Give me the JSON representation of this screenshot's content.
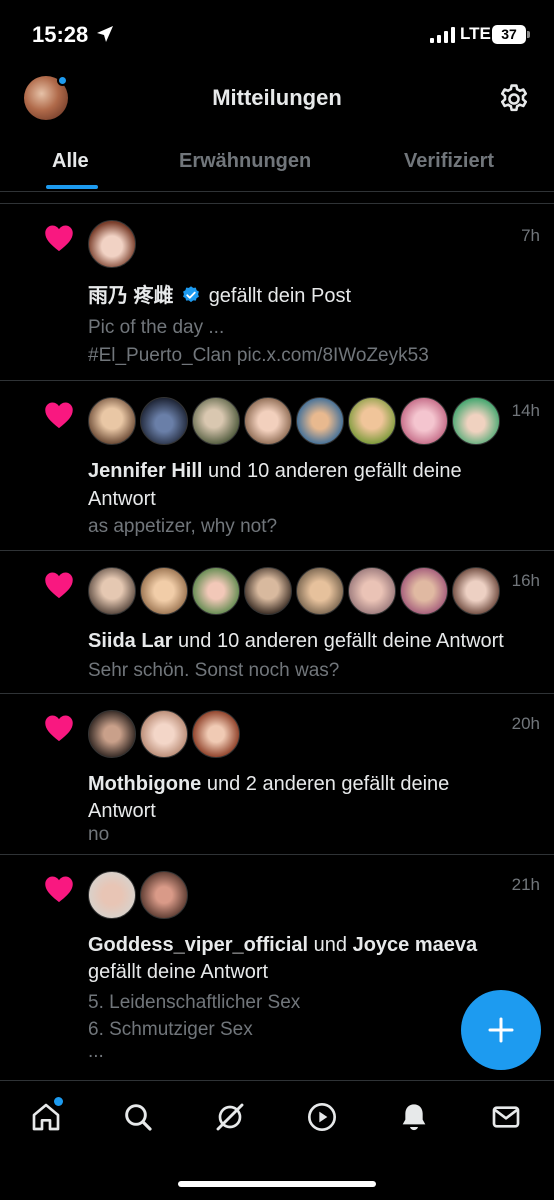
{
  "status_bar": {
    "time": "15:28",
    "network": "LTE",
    "battery": "37"
  },
  "header": {
    "title": "Mitteilungen"
  },
  "tabs": [
    {
      "label": "Alle",
      "active": true
    },
    {
      "label": "Erwähnungen",
      "active": false
    },
    {
      "label": "Verifiziert",
      "active": false
    }
  ],
  "notifications": [
    {
      "time": "7h",
      "actor": "雨乃 疼雌",
      "verified": true,
      "action": "gefällt dein Post",
      "sub1": "Pic of the day ...",
      "sub2": "#El_Puerto_Clan pic.x.com/8IWoZeyk53"
    },
    {
      "time": "14h",
      "actor": "Jennifer Hill",
      "action": "und 10 anderen gefällt deine",
      "action2": "Antwort",
      "sub1": "as appetizer, why not?"
    },
    {
      "time": "16h",
      "actor": "Siida Lar",
      "action": "und 10 anderen gefällt deine Antwort",
      "sub1": "Sehr schön. Sonst noch was?"
    },
    {
      "time": "20h",
      "actor": "Mothbigone",
      "action": "und 2 anderen gefällt deine",
      "action2": "Antwort",
      "sub1": "no"
    },
    {
      "time": "21h",
      "actor": "Goddess_viper_official",
      "connector": "und",
      "actor2": "Joyce maeva",
      "action": "gefällt deine Antwort",
      "sub1": "5. Leidenschaftlicher Sex",
      "sub2": "6. Schmutziger Sex",
      "sub3": "..."
    }
  ],
  "colors": {
    "accent": "#1d9bf0",
    "heart": "#f91880",
    "muted": "#71767b",
    "background": "#000000"
  },
  "bottom_nav": [
    "home-icon",
    "search-icon",
    "grok-icon",
    "video-icon",
    "notifications-icon",
    "messages-icon"
  ]
}
